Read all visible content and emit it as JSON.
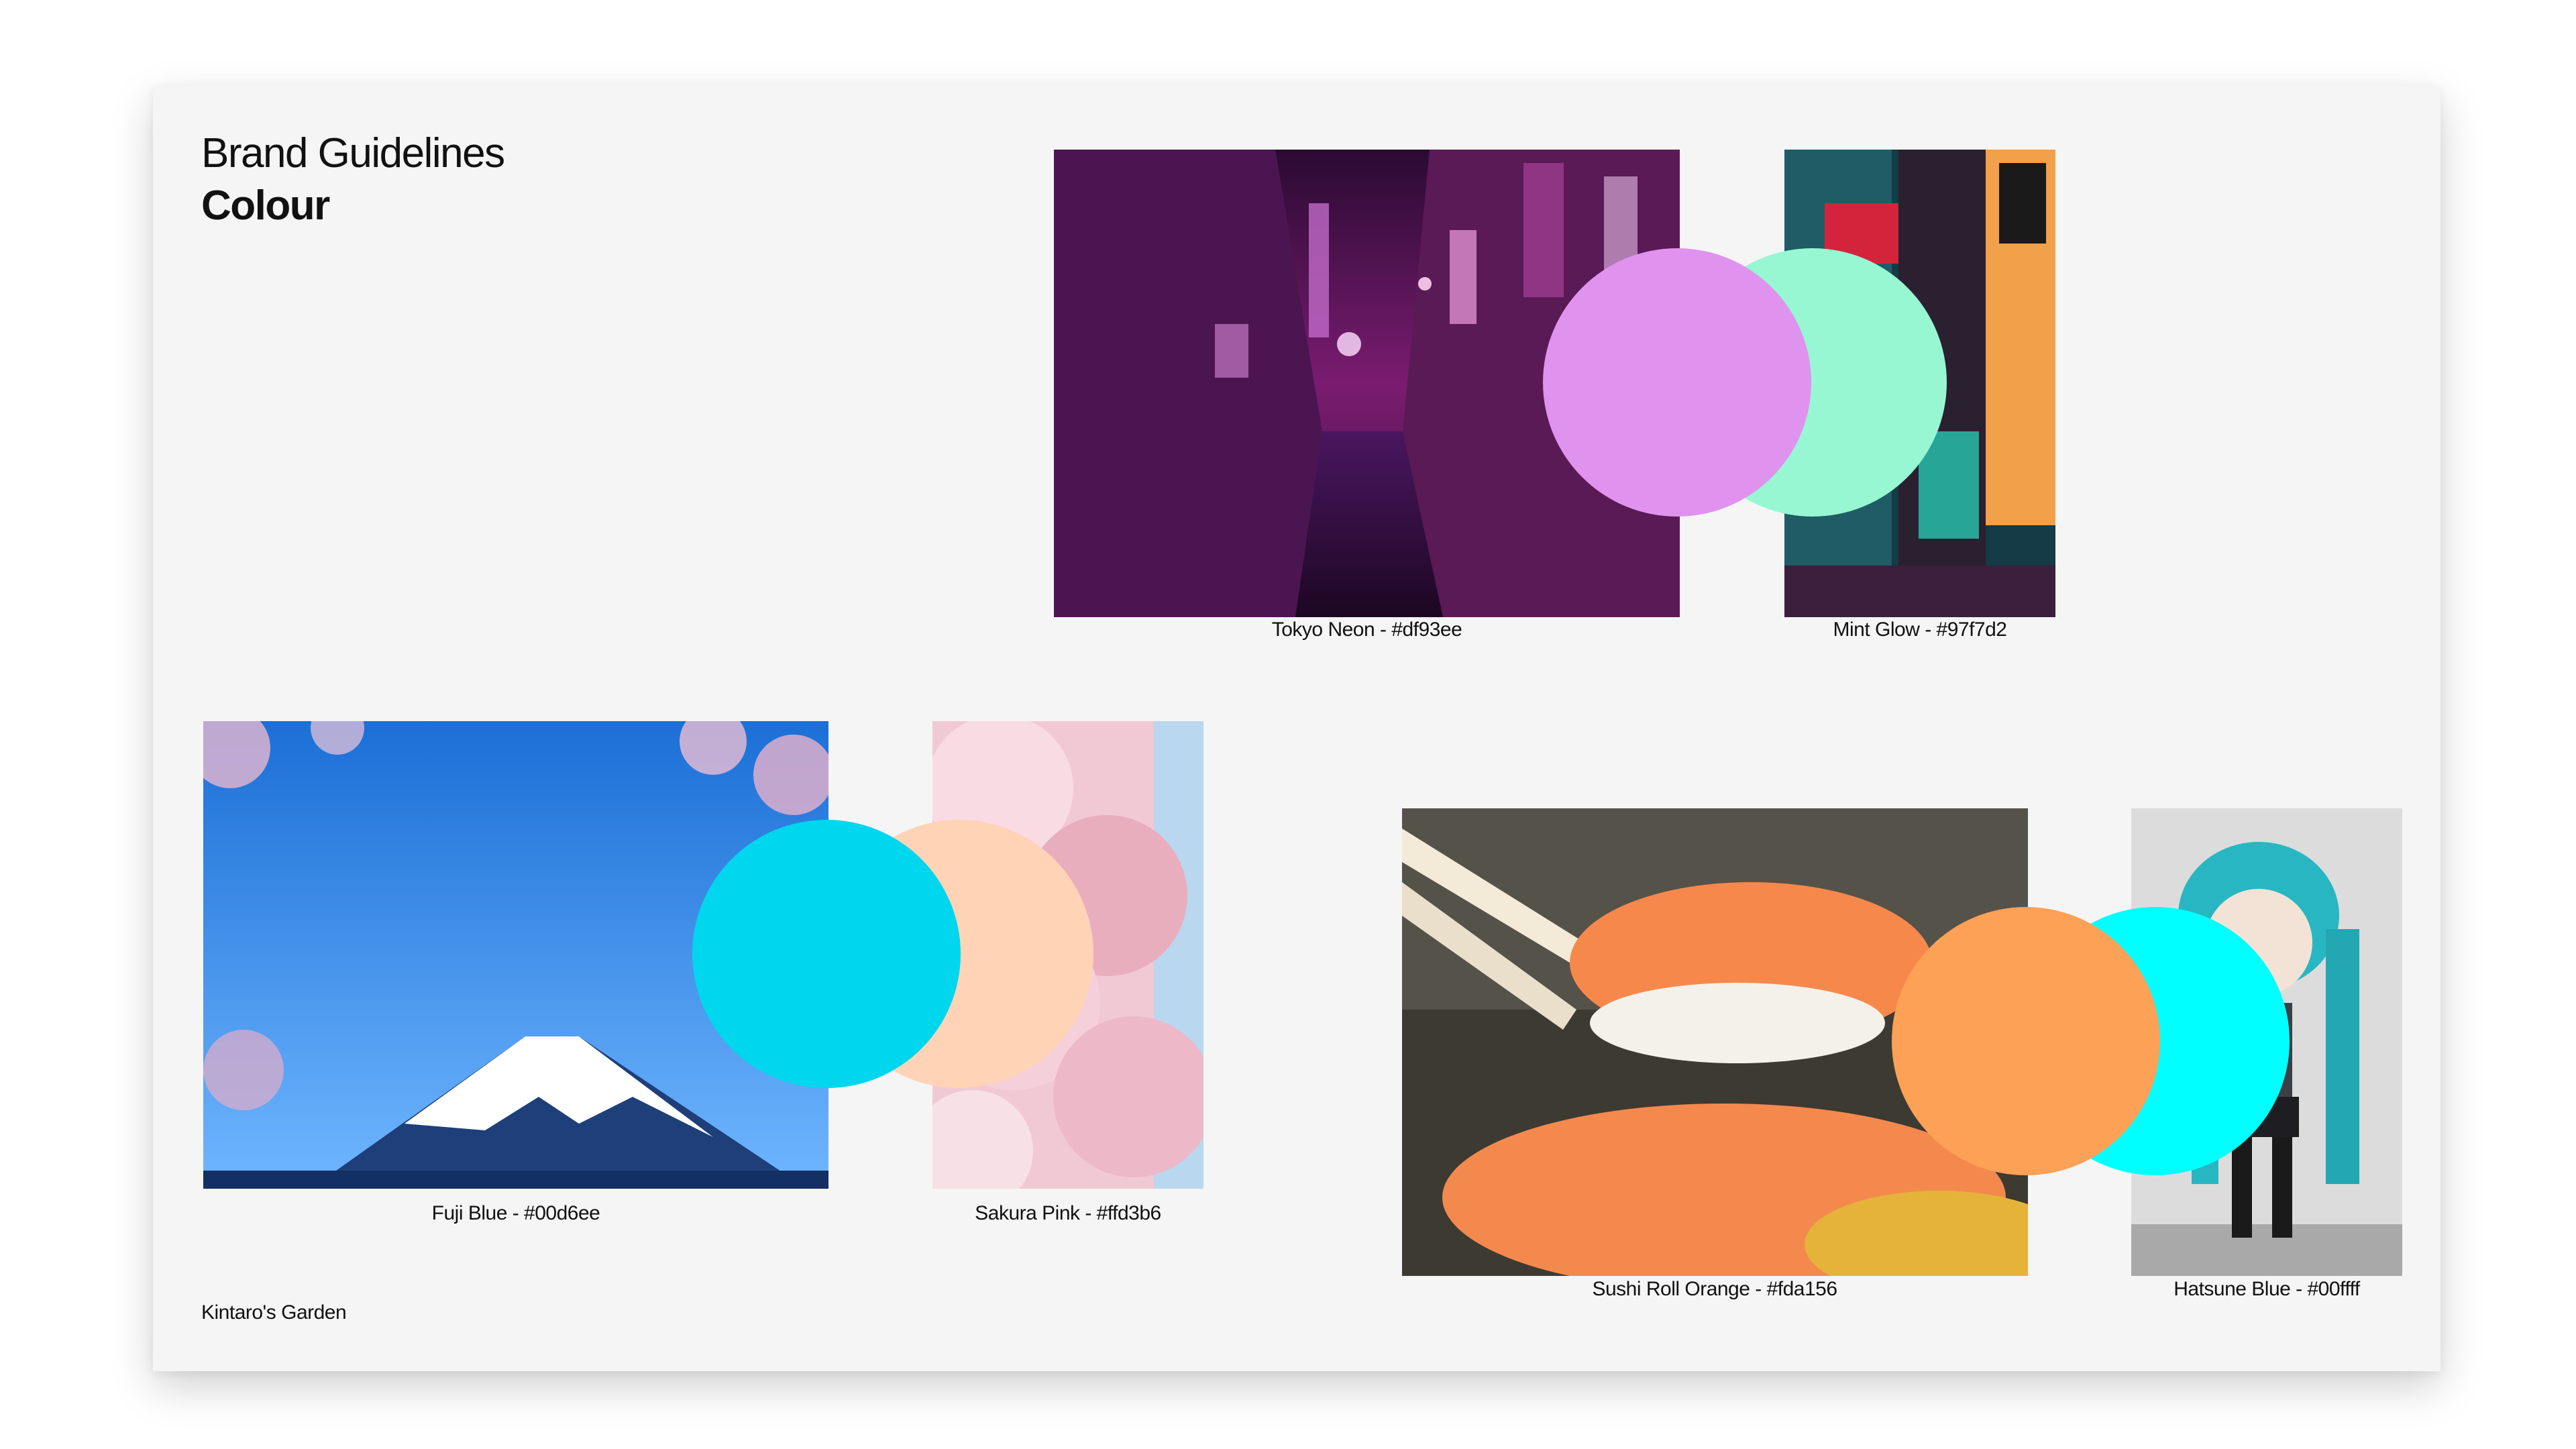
{
  "header": {
    "title": "Brand Guidelines",
    "subtitle": "Colour"
  },
  "footer": {
    "brand": "Kintaro's Garden"
  },
  "colors": {
    "tokyo_neon": "#df93ee",
    "mint_glow": "#97f7d2",
    "fuji_blue": "#00d6ee",
    "sakura_pink": "#ffd3b6",
    "sushi_roll_orange": "#fda156",
    "hatsune_blue": "#00ffff"
  },
  "groups": [
    {
      "photos": [
        {
          "subject": "tokyo-neon-street-photo",
          "caption": "Tokyo Neon - #df93ee"
        },
        {
          "subject": "neon-signs-photo",
          "caption": "Mint Glow - #97f7d2"
        }
      ]
    },
    {
      "photos": [
        {
          "subject": "mount-fuji-photo",
          "caption": "Fuji Blue - #00d6ee"
        },
        {
          "subject": "cherry-blossom-photo",
          "caption": "Sakura Pink - #ffd3b6"
        }
      ]
    },
    {
      "photos": [
        {
          "subject": "salmon-sushi-photo",
          "caption": "Sushi Roll Orange - #fda156"
        },
        {
          "subject": "hatsune-figure-photo",
          "caption": "Hatsune Blue - #00ffff"
        }
      ]
    }
  ]
}
